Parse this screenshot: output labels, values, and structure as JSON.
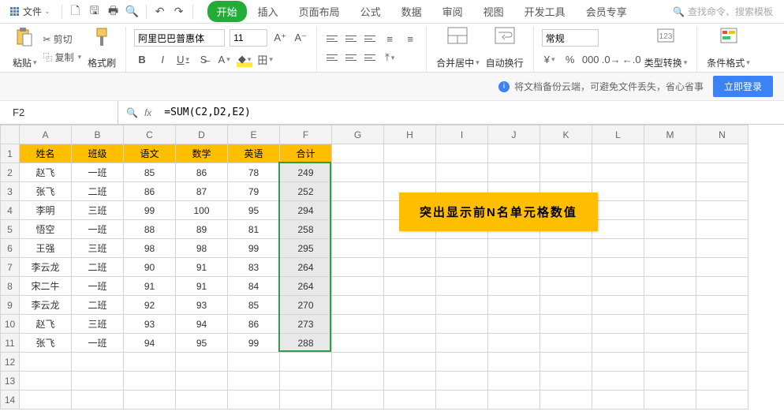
{
  "menu": {
    "file": "文件",
    "tabs": [
      "开始",
      "插入",
      "页面布局",
      "公式",
      "数据",
      "审阅",
      "视图",
      "开发工具",
      "会员专享"
    ],
    "activeTab": 0,
    "search": "查找命令、搜索模板"
  },
  "ribbon": {
    "paste": "粘贴",
    "cut": "剪切",
    "copy": "复制",
    "formatPainter": "格式刷",
    "font": "阿里巴巴普惠体",
    "fontSize": "11",
    "merge": "合并居中",
    "wrap": "自动换行",
    "numFormat": "常规",
    "typeConv": "类型转换",
    "condFmt": "条件格式"
  },
  "info": {
    "msg": "将文档备份云端，可避免文件丢失，省心省事",
    "login": "立即登录"
  },
  "fx": {
    "cellRef": "F2",
    "formula": "=SUM(C2,D2,E2)"
  },
  "sheet": {
    "cols": [
      "A",
      "B",
      "C",
      "D",
      "E",
      "F",
      "G",
      "H",
      "I",
      "J",
      "K",
      "L",
      "M",
      "N"
    ],
    "headers": [
      "姓名",
      "班级",
      "语文",
      "数学",
      "英语",
      "合计"
    ],
    "rows": [
      [
        "赵飞",
        "一班",
        "85",
        "86",
        "78",
        "249"
      ],
      [
        "张飞",
        "二班",
        "86",
        "87",
        "79",
        "252"
      ],
      [
        "李明",
        "三班",
        "99",
        "100",
        "95",
        "294"
      ],
      [
        "悟空",
        "一班",
        "88",
        "89",
        "81",
        "258"
      ],
      [
        "王强",
        "三班",
        "98",
        "98",
        "99",
        "295"
      ],
      [
        "李云龙",
        "二班",
        "90",
        "91",
        "83",
        "264"
      ],
      [
        "宋二牛",
        "一班",
        "91",
        "91",
        "84",
        "264"
      ],
      [
        "李云龙",
        "二班",
        "92",
        "93",
        "85",
        "270"
      ],
      [
        "赵飞",
        "三班",
        "93",
        "94",
        "86",
        "273"
      ],
      [
        "张飞",
        "一班",
        "94",
        "95",
        "99",
        "288"
      ]
    ],
    "note": "突出显示前N名单元格数值"
  }
}
